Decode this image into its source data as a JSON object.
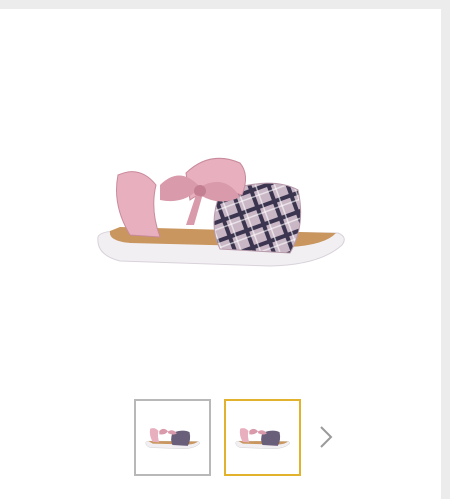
{
  "product": {
    "image_icon": "sandal-image",
    "colors": {
      "strap": "#e8b0be",
      "plaid_base": "#c9b7c6",
      "plaid_dark": "#3b3550",
      "sole": "#f2eff3",
      "insole": "#c8965e"
    }
  },
  "gallery": {
    "thumbnails": [
      {
        "icon": "sandal-thumbnail",
        "selected": false
      },
      {
        "icon": "sandal-thumbnail",
        "selected": true
      }
    ],
    "next_icon": "chevron-right-icon",
    "selected_border_color": "#e2b22c",
    "border_color": "#b8b8b8"
  }
}
